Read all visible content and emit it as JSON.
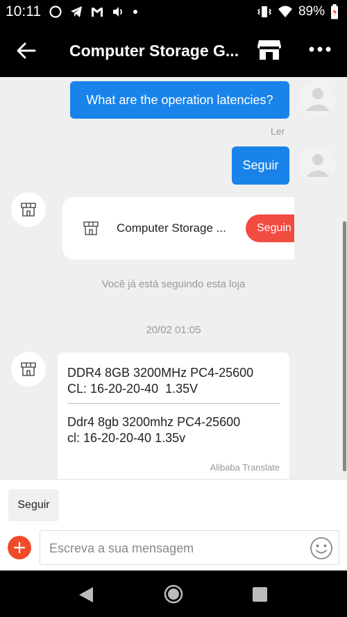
{
  "status_bar": {
    "time": "10:11",
    "battery": "89%"
  },
  "header": {
    "title": "Computer Storage G...",
    "icons": [
      "back-arrow-icon",
      "store-icon",
      "more-icon"
    ]
  },
  "messages": [
    {
      "type": "outgoing",
      "text": "What are the operation latencies?",
      "status": "Ler"
    },
    {
      "type": "outgoing",
      "text": "Seguir"
    },
    {
      "type": "shop_card",
      "shop_name": "Computer Storage ...",
      "button": "Seguin"
    },
    {
      "type": "system",
      "text": "Você já está seguindo esta loja"
    },
    {
      "type": "timestamp",
      "text": "20/02 01:05"
    },
    {
      "type": "incoming",
      "original": "DDR4 8GB 3200MHz PC4-25600\nCL: 16-20-20-40  1.35V",
      "translated": "Ddr4 8gb 3200mhz PC4-25600\ncl: 16-20-20-40 1.35v",
      "translator": "Alibaba Translate"
    }
  ],
  "quick_replies": [
    "Seguir"
  ],
  "composer": {
    "placeholder": "Escreva a sua mensagem",
    "value": ""
  },
  "colors": {
    "accent_blue": "#1a83ea",
    "follow_red": "#f24b42",
    "add_orange": "#f24b2a",
    "chat_bg": "#efefef"
  }
}
